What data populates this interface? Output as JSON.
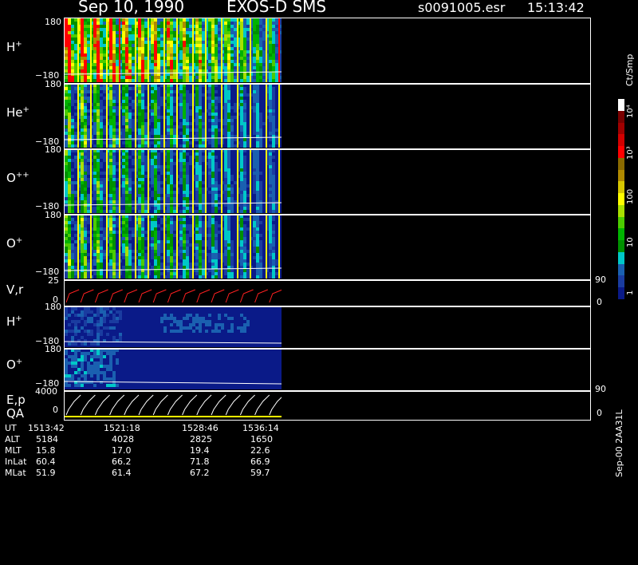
{
  "header": {
    "date": "Sep 10, 1990",
    "title": "EXOS-D SMS",
    "file": "s0091005.esr",
    "time": "15:13:42"
  },
  "panels": [
    {
      "label_main": "H",
      "label_sup": "+",
      "y_top": "180",
      "y_bottom": "−180"
    },
    {
      "label_main": "He",
      "label_sup": "+",
      "y_top": "180",
      "y_bottom": "−180"
    },
    {
      "label_main": "O",
      "label_sup": "++",
      "y_top": "180",
      "y_bottom": "−180"
    },
    {
      "label_main": "O",
      "label_sup": "+",
      "y_top": "180",
      "y_bottom": "−180"
    },
    {
      "label_main": "V,r",
      "label_sup": "",
      "y_top": "25",
      "y_bottom": "0",
      "right_top": "90",
      "right_bottom": "0"
    },
    {
      "label_main": "H",
      "label_sup": "+",
      "y_top": "180",
      "y_bottom": "−180"
    },
    {
      "label_main": "O",
      "label_sup": "+",
      "y_top": "180",
      "y_bottom": "−180"
    },
    {
      "label_main": "E,p",
      "label_sup": "",
      "y_top": "4000",
      "y_bottom": "0",
      "right_top": "90",
      "right_bottom": "0"
    }
  ],
  "qa_label": "QA",
  "colorbar": {
    "unit": "Ct/Smp",
    "ticks": [
      "10⁴",
      "10³",
      "100",
      "10",
      "1"
    ],
    "colors": [
      "#ffffff",
      "#7a0000",
      "#a00000",
      "#d20000",
      "#ff0000",
      "#8a6a00",
      "#b08a00",
      "#d6c600",
      "#ffff00",
      "#a8e000",
      "#4ccc00",
      "#00b400",
      "#009000",
      "#00c8c8",
      "#1a60b0",
      "#1a3ca0",
      "#0a1a88"
    ]
  },
  "footer": {
    "labels": [
      "UT",
      "ALT",
      "MLT",
      "InLat",
      "MLat"
    ],
    "columns": [
      [
        "1513:42",
        "5184",
        "15.8",
        "60.4",
        "51.9"
      ],
      [
        "1521:18",
        "4028",
        "17.0",
        "66.2",
        "61.4"
      ],
      [
        "1528:46",
        "2825",
        "19.4",
        "71.8",
        "67.2"
      ],
      [
        "1536:14",
        "1650",
        "22.6",
        "66.9",
        "59.7"
      ]
    ]
  },
  "side_note": "Sep-00 2AA31L",
  "chart_data": {
    "type": "heatmap",
    "title": "Sep 10, 1990   EXOS-D SMS",
    "x_tick_labels": [
      "1513:42",
      "1521:18",
      "1528:46",
      "1536:14"
    ],
    "panels": [
      "H+",
      "He+",
      "O++",
      "O+",
      "V,r",
      "H+",
      "O+",
      "E,p"
    ],
    "ylim_pitch_panels": [
      -180,
      180
    ],
    "vr_ylim": [
      0,
      25
    ],
    "ep_ylim": [
      0,
      4000
    ],
    "right_axis": [
      0,
      90
    ],
    "colorbar_unit": "Ct/Smp",
    "colorbar_range": [
      1,
      10000
    ],
    "data_ends_fraction": 0.41
  }
}
